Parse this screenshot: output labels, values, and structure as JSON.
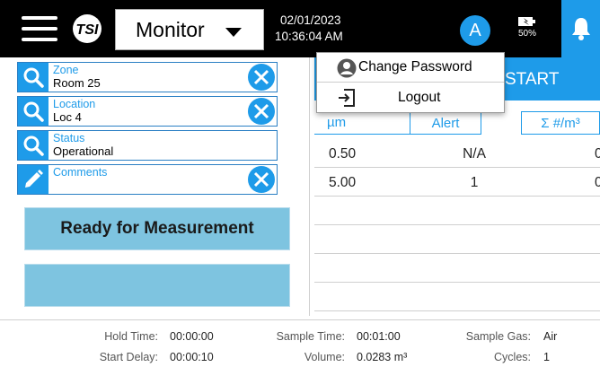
{
  "header": {
    "mode_label": "Monitor",
    "date": "02/01/2023",
    "time": "10:36:04 AM",
    "user_initial": "A",
    "battery_label": "50%",
    "accent_color": "#1e9be9"
  },
  "fields": [
    {
      "label": "Zone",
      "value": "Room 25",
      "icon": "search-icon",
      "clearable": true
    },
    {
      "label": "Location",
      "value": "Loc 4",
      "icon": "search-icon",
      "clearable": true
    },
    {
      "label": "Status",
      "value": "Operational",
      "icon": "search-icon",
      "clearable": false
    },
    {
      "label": "Comments",
      "value": "",
      "icon": "pencil-icon",
      "clearable": true
    }
  ],
  "buttons": {
    "ready_label": "Ready for Measurement",
    "start_label": "START"
  },
  "user_menu": {
    "items": [
      {
        "label": "Change Password",
        "icon": "user-circle-icon"
      },
      {
        "label": "Logout",
        "icon": "logout-icon"
      }
    ]
  },
  "table": {
    "headers": [
      "µm",
      "Alert",
      "Σ #/m³"
    ],
    "rows": [
      {
        "size": "0.50",
        "alert": "N/A",
        "count": "0"
      },
      {
        "size": "5.00",
        "alert": "1",
        "count": "0"
      }
    ]
  },
  "footer": {
    "hold_time_label": "Hold Time:",
    "hold_time": "00:00:00",
    "start_delay_label": "Start Delay:",
    "start_delay": "00:00:10",
    "sample_time_label": "Sample Time:",
    "sample_time": "00:01:00",
    "volume_label": "Volume:",
    "volume": "0.0283 m³",
    "sample_gas_label": "Sample Gas:",
    "sample_gas": "Air",
    "cycles_label": "Cycles:",
    "cycles": "1"
  }
}
